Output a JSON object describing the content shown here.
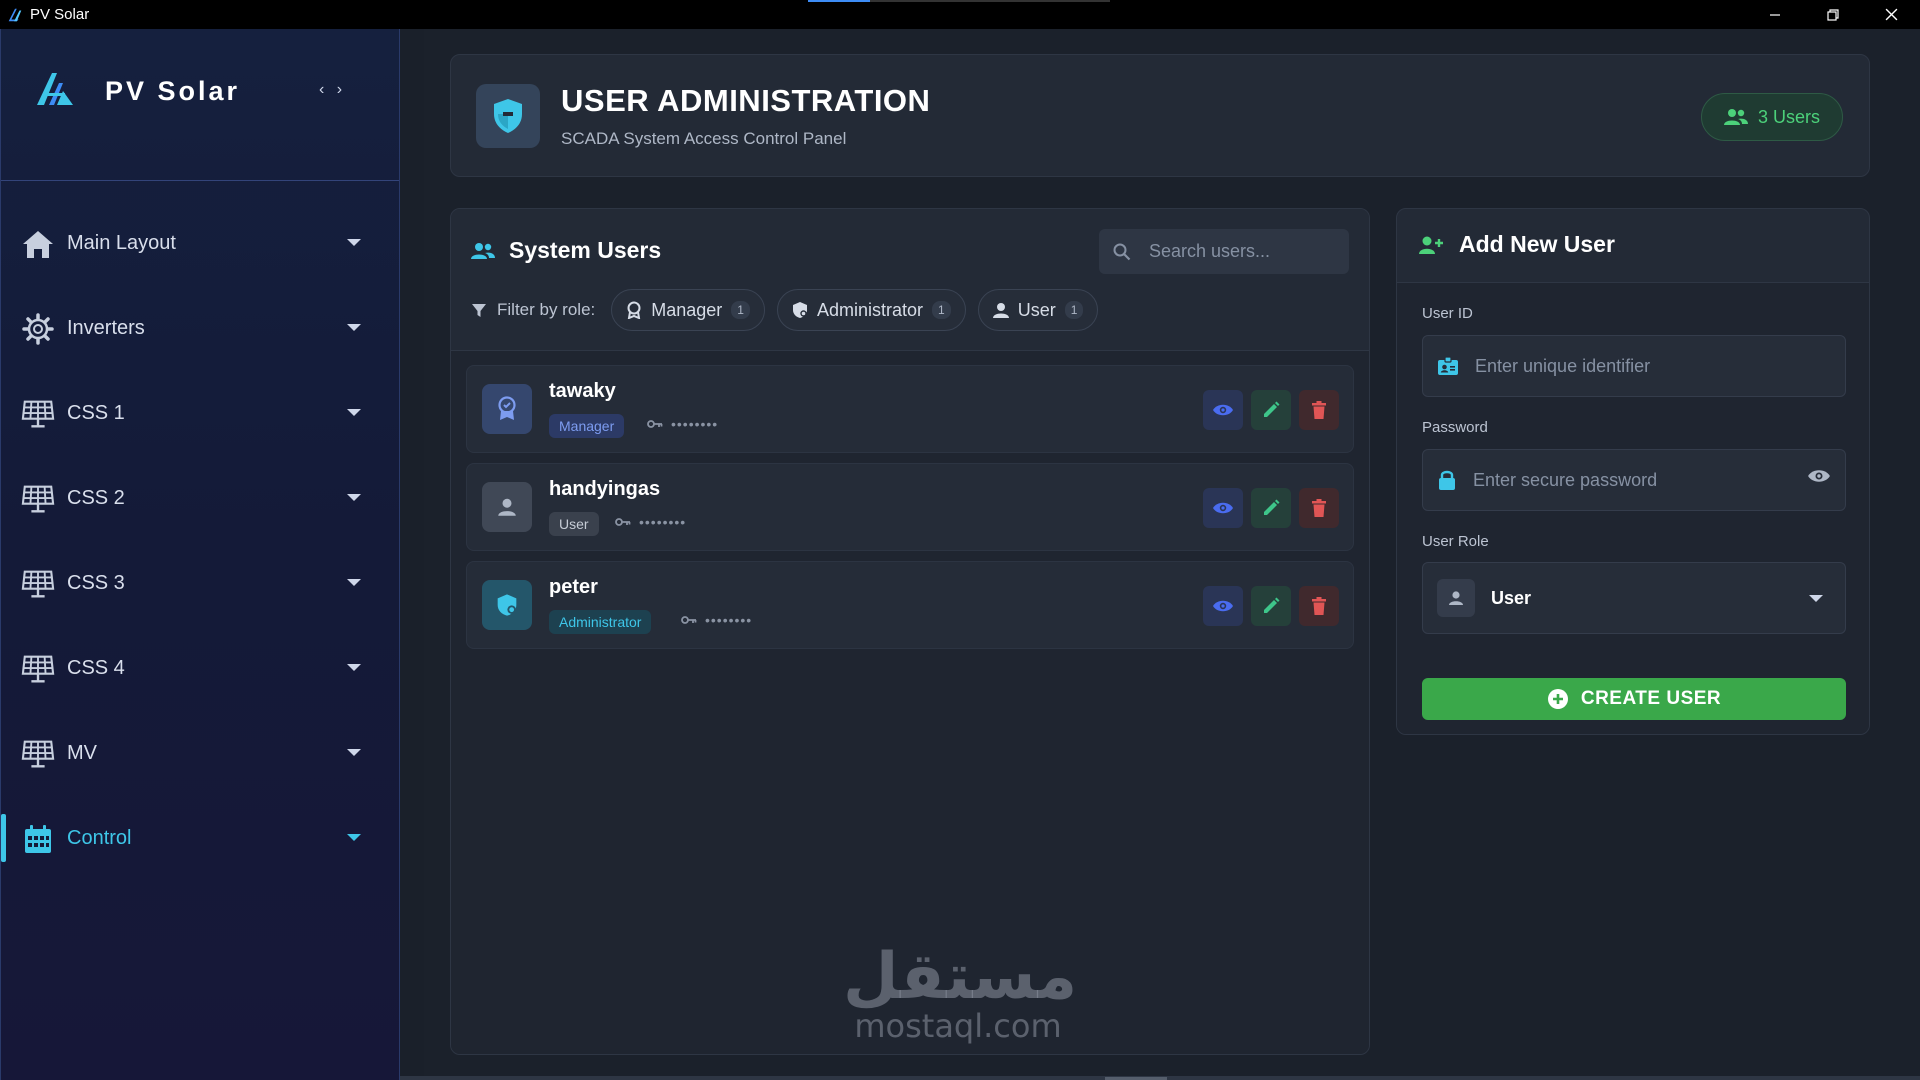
{
  "window": {
    "title": "PV Solar",
    "controls": {
      "minimize": "—",
      "maximize": "❐",
      "close": "✕"
    }
  },
  "sidebar": {
    "brand": "PV Solar",
    "collapse_label": "‹ ›",
    "items": [
      {
        "label": "Main Layout",
        "icon": "home-icon",
        "active": false
      },
      {
        "label": "Inverters",
        "icon": "gear-icon",
        "active": false
      },
      {
        "label": "CSS 1",
        "icon": "solar-panel-icon",
        "active": false
      },
      {
        "label": "CSS 2",
        "icon": "solar-panel-icon",
        "active": false
      },
      {
        "label": "CSS 3",
        "icon": "solar-panel-icon",
        "active": false
      },
      {
        "label": "CSS 4",
        "icon": "solar-panel-icon",
        "active": false
      },
      {
        "label": "MV",
        "icon": "solar-panel-icon",
        "active": false
      },
      {
        "label": "Control",
        "icon": "calendar-icon",
        "active": true
      }
    ]
  },
  "header": {
    "title": "USER ADMINISTRATION",
    "subtitle": "SCADA System Access Control Panel",
    "users_badge": "3 Users"
  },
  "users_panel": {
    "title": "System Users",
    "search_placeholder": "Search users...",
    "filter_label": "Filter by role:",
    "filters": [
      {
        "label": "Manager",
        "count": "1"
      },
      {
        "label": "Administrator",
        "count": "1"
      },
      {
        "label": "User",
        "count": "1"
      }
    ],
    "users": [
      {
        "name": "tawaky",
        "role": "Manager",
        "password": "••••••••"
      },
      {
        "name": "handyingas",
        "role": "User",
        "password": "••••••••"
      },
      {
        "name": "peter",
        "role": "Administrator",
        "password": "••••••••"
      }
    ]
  },
  "add_user": {
    "title": "Add New User",
    "user_id_label": "User ID",
    "user_id_placeholder": "Enter unique identifier",
    "password_label": "Password",
    "password_placeholder": "Enter secure password",
    "role_label": "User Role",
    "role_value": "User",
    "create_label": "CREATE USER"
  },
  "watermark": {
    "arabic": "مستقل",
    "latin": "mostaql.com"
  },
  "colors": {
    "accent": "#3ec6e8",
    "success": "#3aa84a",
    "danger": "#e05555",
    "view": "#4a6cf0"
  }
}
